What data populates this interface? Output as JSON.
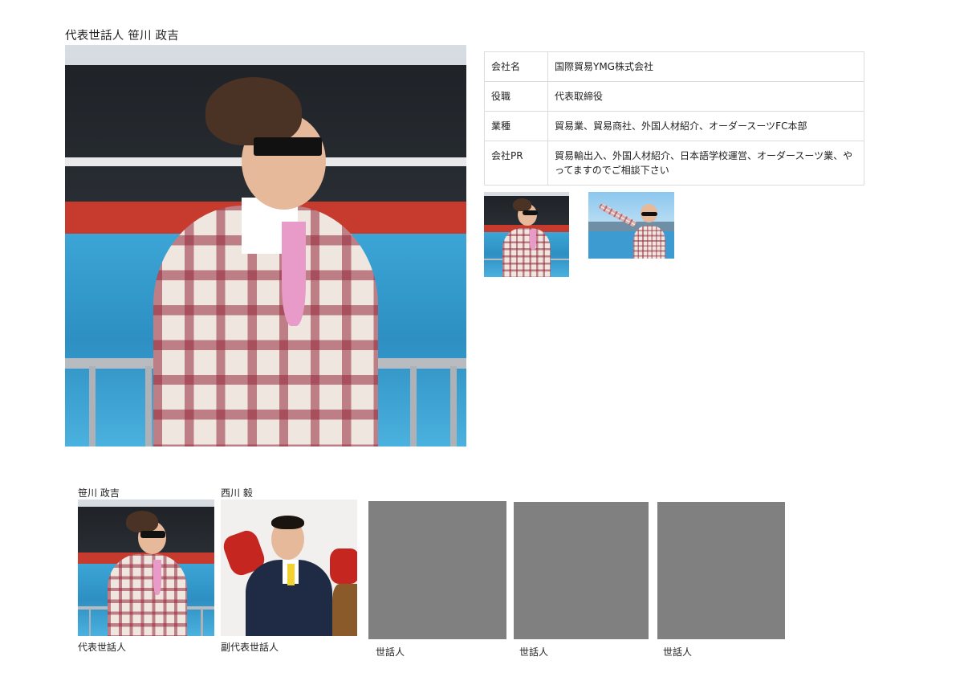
{
  "profile": {
    "title": "代表世話人 笹川 政吉",
    "photo_alt": "笹川 政吉",
    "table": [
      {
        "key": "会社名",
        "value": "国際貿易YMG株式会社"
      },
      {
        "key": "役職",
        "value": "代表取締役"
      },
      {
        "key": "業種",
        "value": "貿易業、貿易商社、外国人材紹介、オーダースーツFC本部"
      },
      {
        "key": "会社PR",
        "value": "貿易輸出入、外国人材紹介、日本語学校運営、オーダースーツ業、やってますのでご相談下さい"
      }
    ]
  },
  "members": [
    {
      "name": "笹川 政吉",
      "role": "代表世話人"
    },
    {
      "name": "西川 毅",
      "role": "副代表世話人"
    },
    {
      "name": "",
      "role": "世話人"
    },
    {
      "name": "",
      "role": "世話人"
    },
    {
      "name": "",
      "role": "世話人"
    }
  ]
}
